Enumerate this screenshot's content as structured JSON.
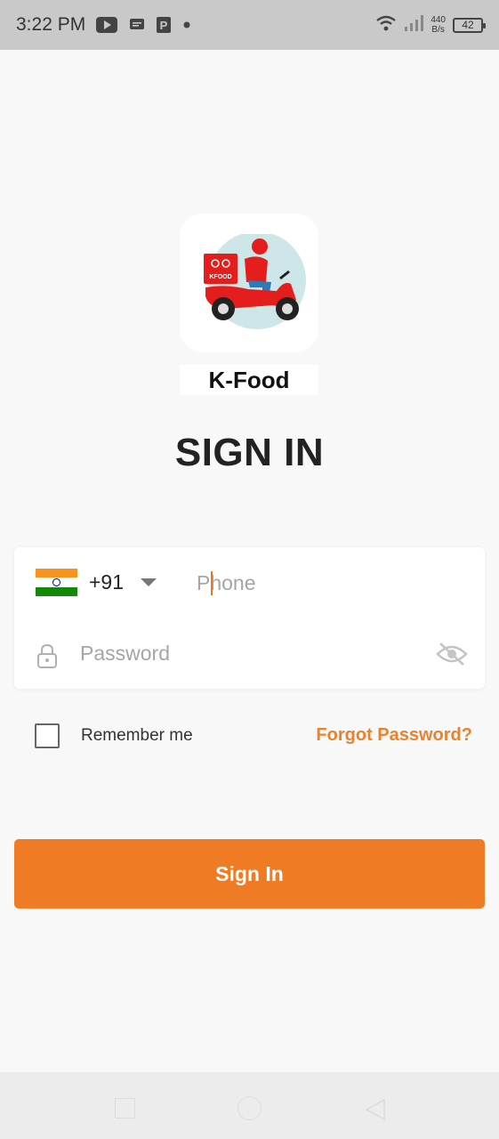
{
  "status_bar": {
    "time": "3:22 PM",
    "net_speed_value": "440",
    "net_speed_unit": "B/s",
    "battery_level": "42"
  },
  "logo": {
    "badge_text": "KFOOD",
    "caption": "K-Food"
  },
  "page_title": "SIGN IN",
  "form": {
    "country_code": "+91",
    "phone_placeholder": "Phone",
    "password_placeholder": "Password"
  },
  "remember": {
    "label": "Remember me",
    "checked": false
  },
  "forgot_password_label": "Forgot Password?",
  "sign_in_button_label": "Sign In",
  "colors": {
    "accent": "#ef7c24",
    "link": "#e9822d",
    "status_bar": "#c9c9c9",
    "background": "#f8f8f8"
  },
  "icons": {
    "status": [
      "youtube-icon",
      "message-icon",
      "parking-app-icon",
      "dot-icon",
      "wifi-icon",
      "signal-icon"
    ],
    "form": [
      "india-flag-icon",
      "chevron-down-icon",
      "lock-icon",
      "eye-off-icon"
    ],
    "nav": [
      "recent-apps-icon",
      "home-icon",
      "back-icon"
    ]
  }
}
